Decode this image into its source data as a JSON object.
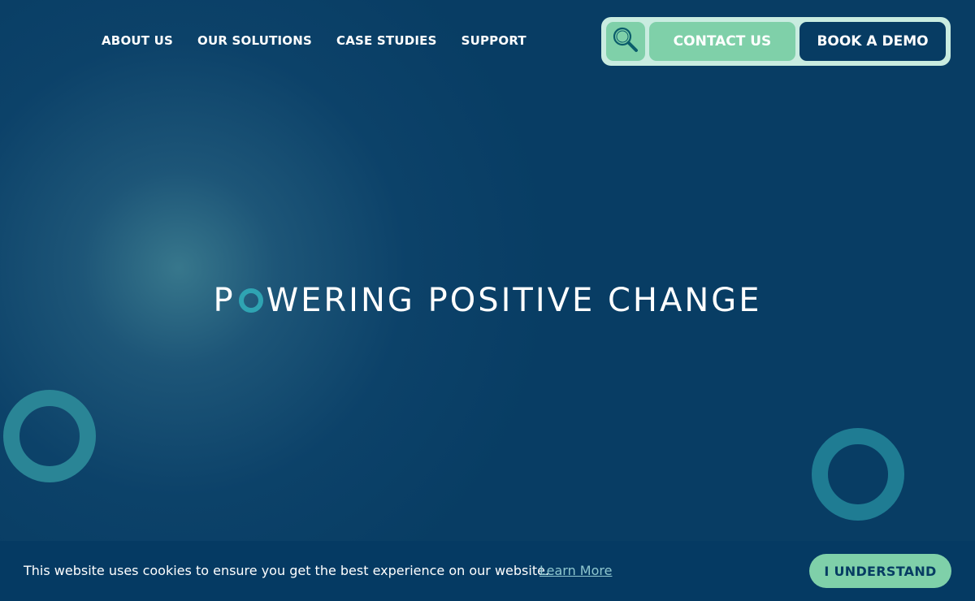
{
  "nav": {
    "items": [
      {
        "label": "ABOUT US"
      },
      {
        "label": "OUR SOLUTIONS"
      },
      {
        "label": "CASE STUDIES"
      },
      {
        "label": "SUPPORT"
      }
    ]
  },
  "actions": {
    "search_icon": "search-icon",
    "contact_label": "CONTACT US",
    "demo_label": "BOOK A DEMO"
  },
  "hero": {
    "headline_first_letter": "P",
    "headline_rest_of_word": "WERING",
    "headline_tail": "POSITIVE CHANGE"
  },
  "cookie": {
    "message": "This website uses cookies to ensure you get the best experience on our website.",
    "learn_more": "Learn More",
    "accept_label": "I UNDERSTAND"
  },
  "colors": {
    "background": "#073c63",
    "accent_green": "#7fd0a9",
    "accent_light": "#c9ece0",
    "ring_teal": "#2fa4b2"
  }
}
